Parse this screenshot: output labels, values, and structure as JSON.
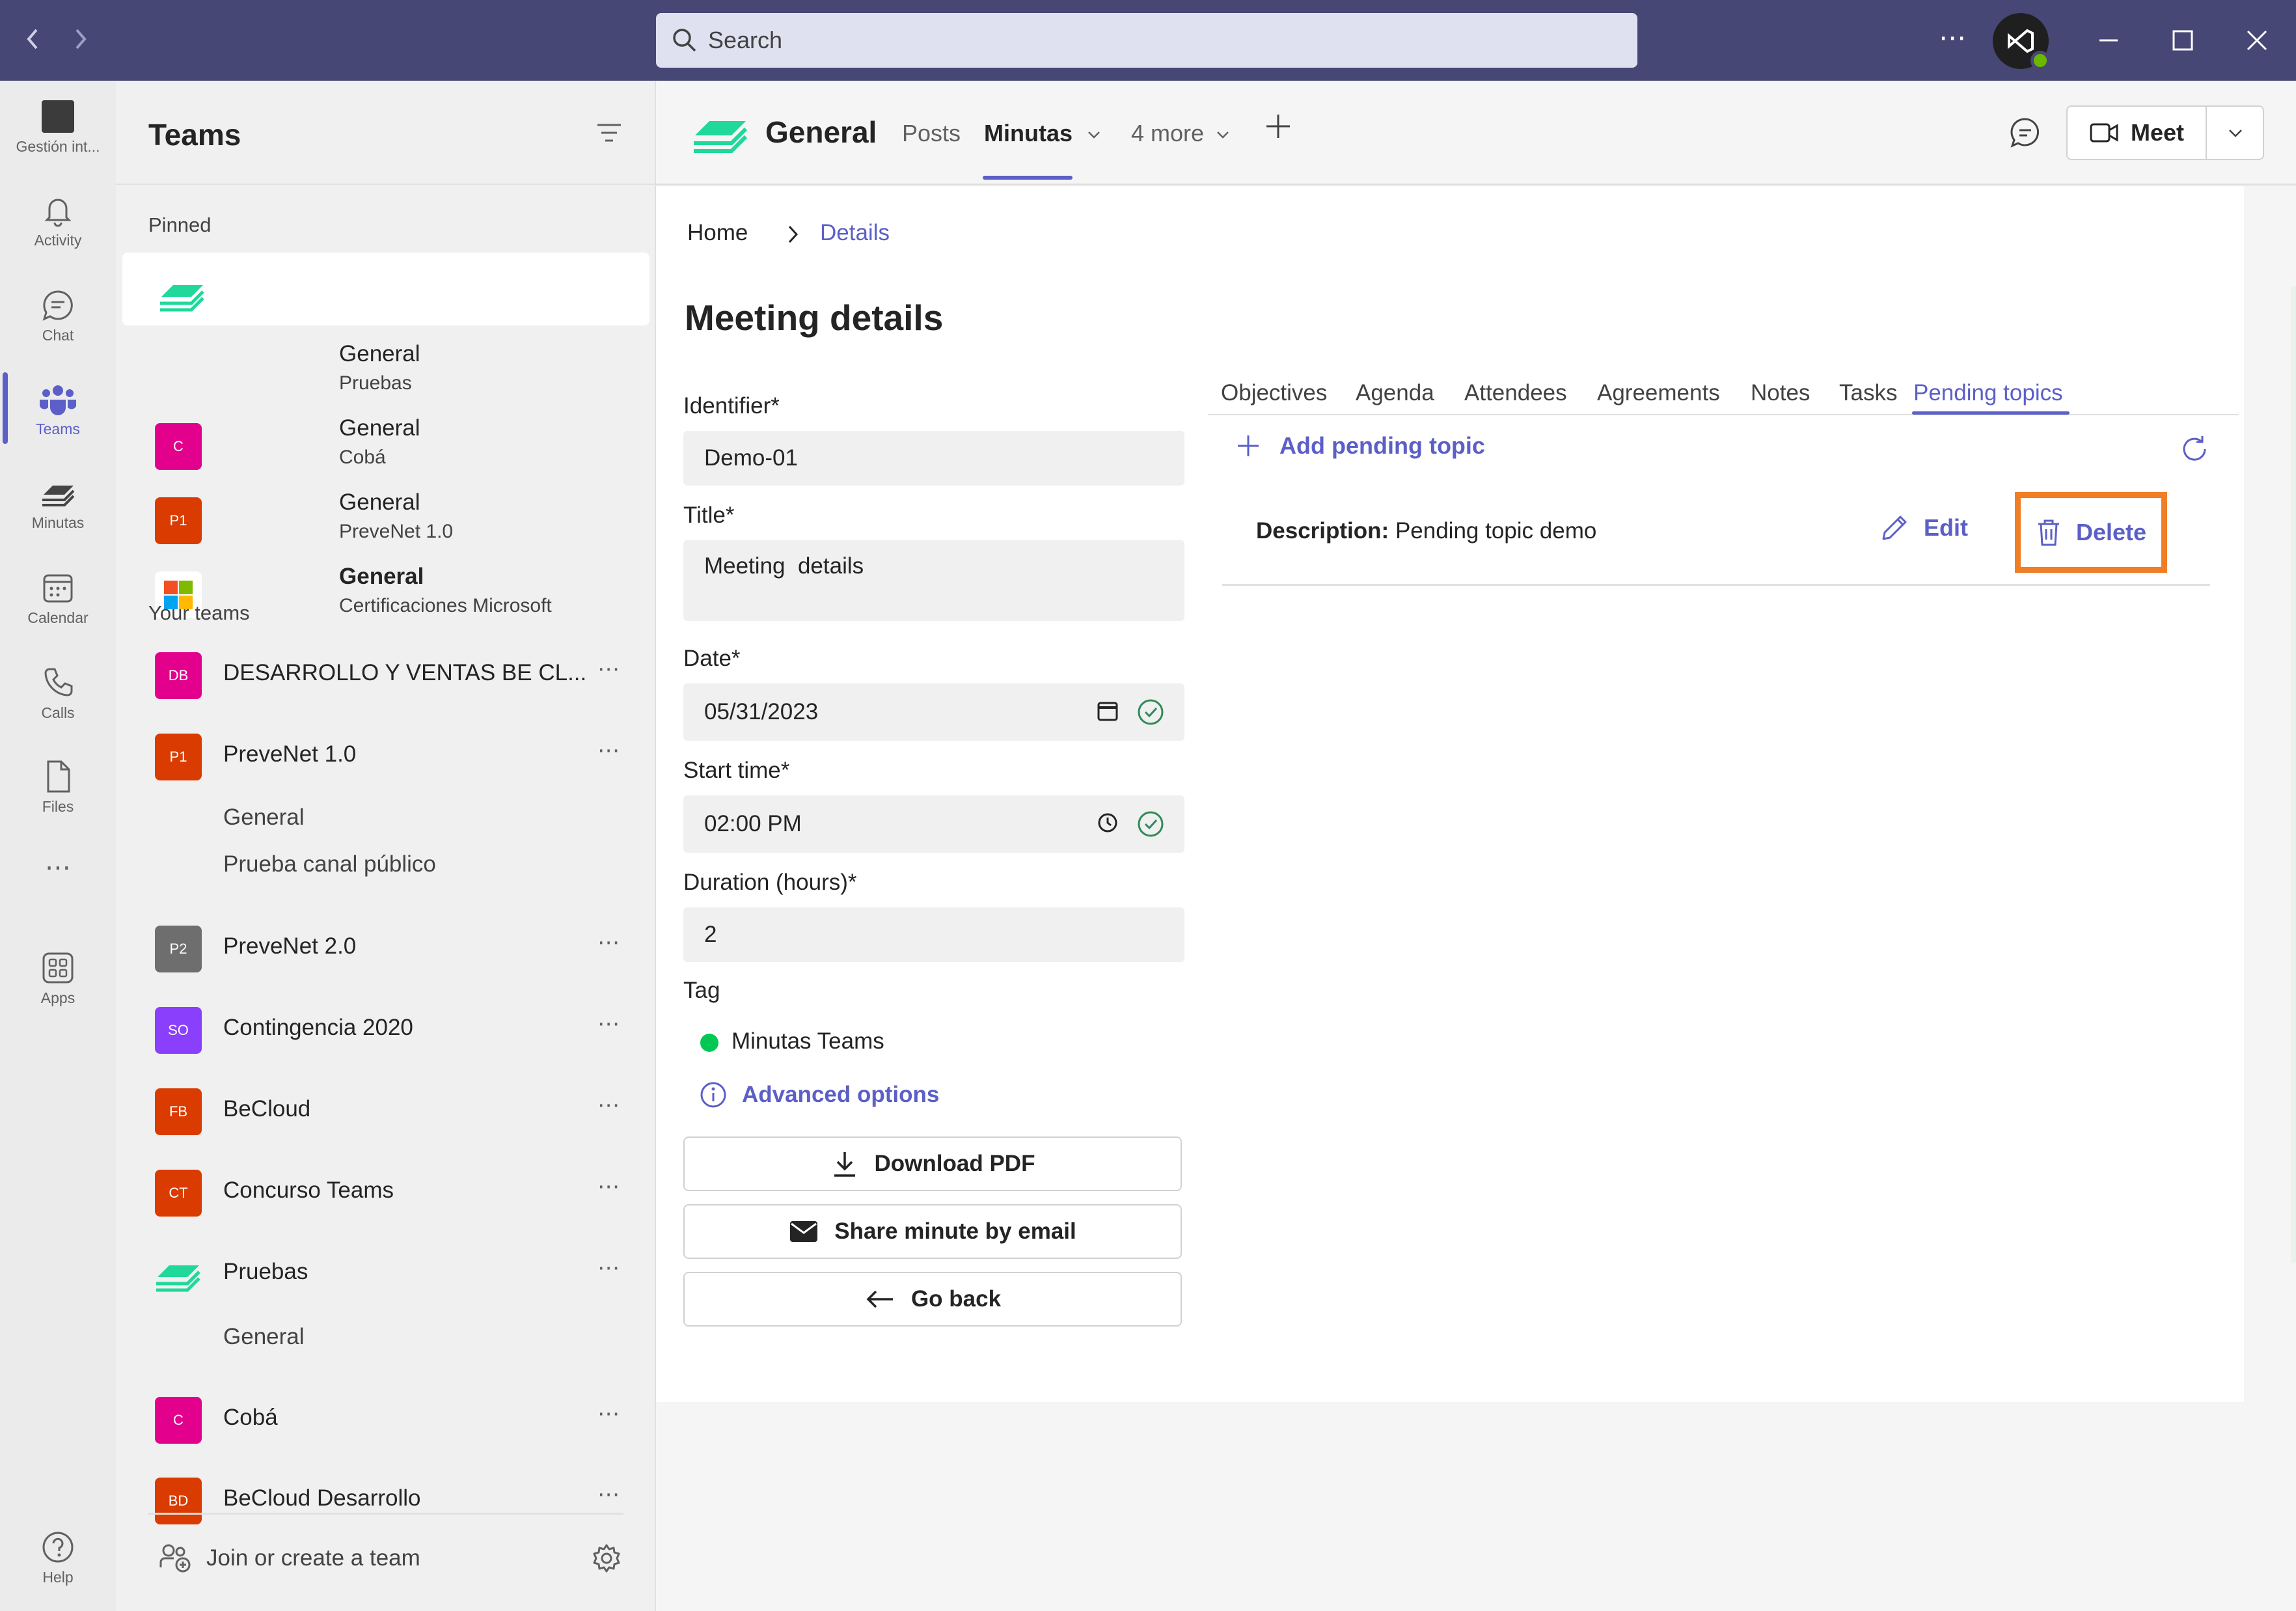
{
  "titlebar": {
    "search_placeholder": "Search",
    "more_label": "⋯"
  },
  "rail": {
    "items": [
      {
        "label": "Gestión int...",
        "icon": "app-icon"
      },
      {
        "label": "Activity",
        "icon": "bell-icon"
      },
      {
        "label": "Chat",
        "icon": "chat-icon"
      },
      {
        "label": "Teams",
        "icon": "teams-icon"
      },
      {
        "label": "Minutas",
        "icon": "minutas-icon"
      },
      {
        "label": "Calendar",
        "icon": "calendar-icon"
      },
      {
        "label": "Calls",
        "icon": "phone-icon"
      },
      {
        "label": "Files",
        "icon": "file-icon"
      },
      {
        "label": "Apps",
        "icon": "apps-icon"
      },
      {
        "label": "Help",
        "icon": "help-icon"
      }
    ],
    "more_label": "⋯",
    "active_color": "#5b5fc7"
  },
  "teams_panel": {
    "title": "Teams",
    "pinned_label": "Pinned",
    "your_teams_label": "Your teams",
    "pinned": [
      {
        "name": "General",
        "team": "Pruebas",
        "tile": "",
        "color": "#1fd89a"
      },
      {
        "name": "General",
        "team": "Cobá",
        "tile": "C",
        "color": "#e3008c"
      },
      {
        "name": "General",
        "team": "PreveNet 1.0",
        "tile": "P1",
        "color": "#da3b01"
      },
      {
        "name": "General",
        "team": "Certificaciones Microsoft",
        "tile": "",
        "color": "#ffffff"
      }
    ],
    "teams": [
      {
        "name": "DESARROLLO Y VENTAS BE CL...",
        "tile": "DB",
        "color": "#e3008c"
      },
      {
        "name": "PreveNet 1.0",
        "tile": "P1",
        "color": "#da3b01",
        "channels": [
          "General",
          "Prueba canal público"
        ]
      },
      {
        "name": "PreveNet 2.0",
        "tile": "P2",
        "color": "#6e6e6e"
      },
      {
        "name": "Contingencia 2020",
        "tile": "SO",
        "color": "#8a3ffc"
      },
      {
        "name": "BeCloud",
        "tile": "FB",
        "color": "#da3b01"
      },
      {
        "name": "Concurso Teams",
        "tile": "CT",
        "color": "#da3b01"
      },
      {
        "name": "Pruebas",
        "tile": "",
        "color": "#1fd89a",
        "channels": [
          "General"
        ]
      },
      {
        "name": "Cobá",
        "tile": "C",
        "color": "#e3008c"
      },
      {
        "name": "BeCloud Desarrollo",
        "tile": "BD",
        "color": "#da3b01"
      }
    ],
    "more_label": "⋯",
    "join_label": "Join or create a team"
  },
  "channel_header": {
    "title": "General",
    "tabs": [
      "Posts",
      "Minutas",
      "4 more"
    ],
    "active_tab": "Minutas",
    "meet_label": "Meet"
  },
  "breadcrumb": {
    "home": "Home",
    "current": "Details"
  },
  "page": {
    "title": "Meeting details",
    "fields": {
      "identifier_label": "Identifier*",
      "identifier_value": "Demo-01",
      "title_label": "Title*",
      "title_value": "Meeting  details",
      "date_label": "Date*",
      "date_value": "05/31/2023",
      "start_label": "Start time*",
      "start_value": "02:00 PM",
      "duration_label": "Duration (hours)*",
      "duration_value": "2",
      "tag_label": "Tag",
      "tag_value": "Minutas Teams"
    },
    "advanced_label": "Advanced options",
    "buttons": {
      "download": "Download PDF",
      "share": "Share minute by email",
      "back": "Go back"
    }
  },
  "detail_tabs": [
    "Objectives",
    "Agenda",
    "Attendees",
    "Agreements",
    "Notes",
    "Tasks",
    "Pending topics"
  ],
  "active_detail_tab": "Pending topics",
  "pending": {
    "add_label": "Add pending topic",
    "items": [
      {
        "label": "Description:",
        "value": "Pending topic demo",
        "edit": "Edit",
        "delete": "Delete"
      }
    ],
    "highlight_color": "#f07e26"
  }
}
